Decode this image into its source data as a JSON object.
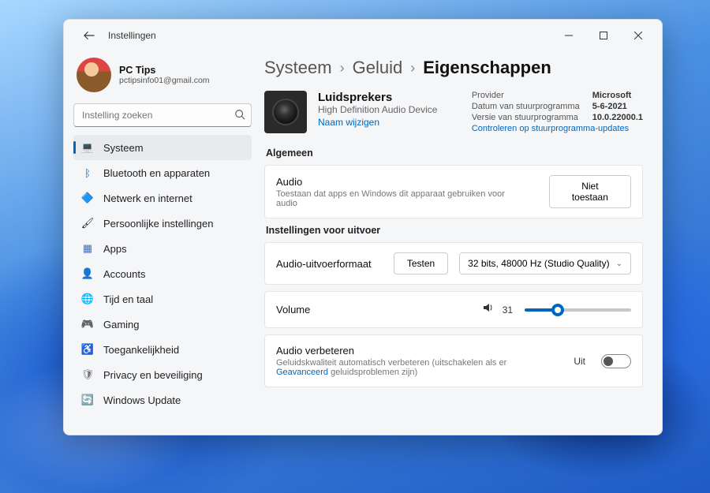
{
  "titlebar": {
    "title": "Instellingen"
  },
  "profile": {
    "name": "PC Tips",
    "email": "pctipsinfo01@gmail.com"
  },
  "search": {
    "placeholder": "Instelling zoeken"
  },
  "nav": [
    {
      "label": "Systeem",
      "icon": "💻"
    },
    {
      "label": "Bluetooth en apparaten",
      "icon": "ᛒ"
    },
    {
      "label": "Netwerk en internet",
      "icon": "🔷"
    },
    {
      "label": "Persoonlijke instellingen",
      "icon": "🖌"
    },
    {
      "label": "Apps",
      "icon": "▦"
    },
    {
      "label": "Accounts",
      "icon": "👤"
    },
    {
      "label": "Tijd en taal",
      "icon": "🌐"
    },
    {
      "label": "Gaming",
      "icon": "🎮"
    },
    {
      "label": "Toegankelijkheid",
      "icon": "♿"
    },
    {
      "label": "Privacy en beveiliging",
      "icon": "🛡"
    },
    {
      "label": "Windows Update",
      "icon": "🔄"
    }
  ],
  "breadcrumb": {
    "a": "Systeem",
    "b": "Geluid",
    "c": "Eigenschappen"
  },
  "device": {
    "name": "Luidsprekers",
    "sub": "High Definition Audio Device",
    "rename": "Naam wijzigen",
    "meta": {
      "provider_k": "Provider",
      "provider_v": "Microsoft",
      "date_k": "Datum van stuurprogramma",
      "date_v": "5-6-2021",
      "version_k": "Versie van stuurprogramma",
      "version_v": "10.0.22000.1",
      "check": "Controleren op stuurprogramma-updates"
    }
  },
  "sections": {
    "general": "Algemeen",
    "output": "Instellingen voor uitvoer"
  },
  "audio_card": {
    "title": "Audio",
    "sub": "Toestaan dat apps en Windows dit apparaat gebruiken voor audio",
    "button": "Niet toestaan"
  },
  "format_card": {
    "title": "Audio-uitvoerformaat",
    "test": "Testen",
    "selected": "32 bits, 48000 Hz (Studio Quality)"
  },
  "volume_card": {
    "title": "Volume",
    "value": "31"
  },
  "enhance_card": {
    "title": "Audio verbeteren",
    "sub_pre": "Geluidskwaliteit automatisch verbeteren (uitschakelen als er ",
    "sub_link": "Geavanceerd",
    "sub_post": " geluidsproblemen zijn)",
    "state": "Uit"
  }
}
